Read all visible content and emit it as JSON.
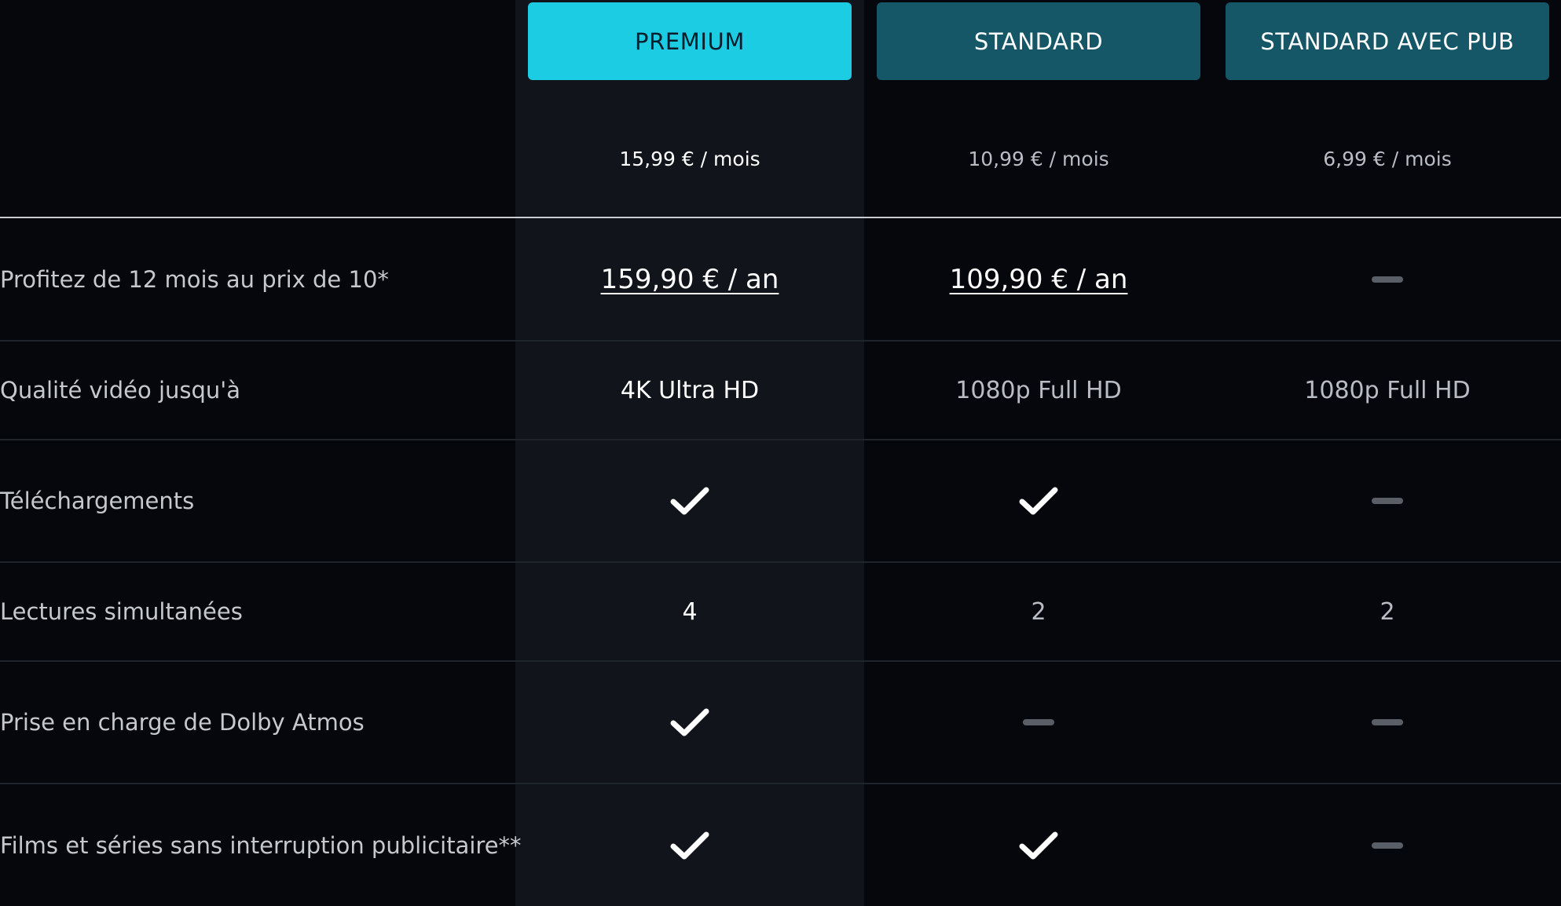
{
  "plans": [
    {
      "name": "PREMIUM",
      "price": "15,99 € / mois",
      "selected": true
    },
    {
      "name": "STANDARD",
      "price": "10,99 € / mois",
      "selected": false
    },
    {
      "name": "STANDARD AVEC PUB",
      "price": "6,99 € / mois",
      "selected": false
    }
  ],
  "features": [
    {
      "label": "Profitez de 12 mois au prix de 10*",
      "values": [
        {
          "kind": "link",
          "text": "159,90 € / an"
        },
        {
          "kind": "link",
          "text": "109,90 € / an"
        },
        {
          "kind": "dash"
        }
      ]
    },
    {
      "label": "Qualité vidéo jusqu'à",
      "values": [
        {
          "kind": "text",
          "text": "4K Ultra HD"
        },
        {
          "kind": "text",
          "text": "1080p Full HD"
        },
        {
          "kind": "text",
          "text": "1080p Full HD"
        }
      ]
    },
    {
      "label": "Téléchargements",
      "values": [
        {
          "kind": "check"
        },
        {
          "kind": "check"
        },
        {
          "kind": "dash"
        }
      ]
    },
    {
      "label": "Lectures simultanées",
      "values": [
        {
          "kind": "text",
          "text": "4"
        },
        {
          "kind": "text",
          "text": "2"
        },
        {
          "kind": "text",
          "text": "2"
        }
      ]
    },
    {
      "label": "Prise en charge de Dolby Atmos",
      "values": [
        {
          "kind": "check"
        },
        {
          "kind": "dash"
        },
        {
          "kind": "dash"
        }
      ]
    },
    {
      "label": "Films et séries sans interruption publicitaire**",
      "values": [
        {
          "kind": "check"
        },
        {
          "kind": "check"
        },
        {
          "kind": "dash"
        }
      ]
    }
  ],
  "colors": {
    "background": "#05070d",
    "premium_column": "#11141b",
    "active_plan": "#1bcce3",
    "inactive_plan": "#155767",
    "dash": "#5a5f67"
  },
  "icons": {
    "check": "check-icon",
    "unavailable": "dash-icon"
  }
}
